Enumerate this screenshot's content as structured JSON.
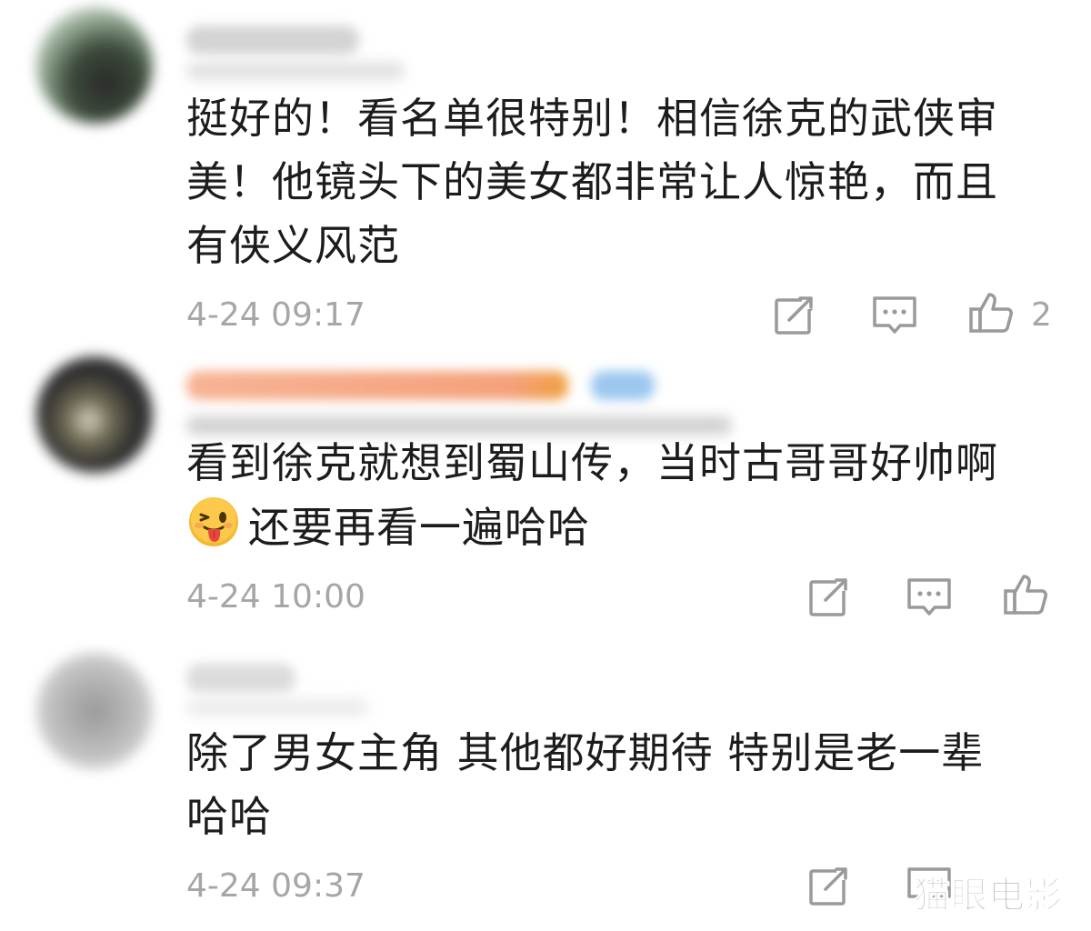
{
  "comments": [
    {
      "text_lines": [
        "挺好的！看名单很特别！相信徐克的武侠审",
        "美！他镜头下的美女都非常让人惊艳，而且",
        "有侠义风范"
      ],
      "timestamp": "4-24 09:17",
      "like_count": "2",
      "icons": [
        "share-icon",
        "reply-icon",
        "like-icon"
      ]
    },
    {
      "text_lines": [
        "看到徐克就想到蜀山传，当时古哥哥好帅啊",
        "还要再看一遍哈哈"
      ],
      "emoji": "tongue-out-emoji",
      "timestamp": "4-24 10:00",
      "like_count": "",
      "icons": [
        "share-icon",
        "reply-icon",
        "like-icon"
      ]
    },
    {
      "text_lines": [
        "除了男女主角 其他都好期待 特别是老一辈",
        "哈哈"
      ],
      "timestamp": "4-24 09:37",
      "like_count": "",
      "icons": [
        "share-icon",
        "reply-icon"
      ]
    }
  ],
  "watermark": "猫眼电影",
  "colors": {
    "text": "#1c1c1c",
    "meta": "#a6a6a6",
    "icon": "#9a9a9a",
    "username_orange": "#f5a07a",
    "badge_blue": "#9cc7ef"
  }
}
